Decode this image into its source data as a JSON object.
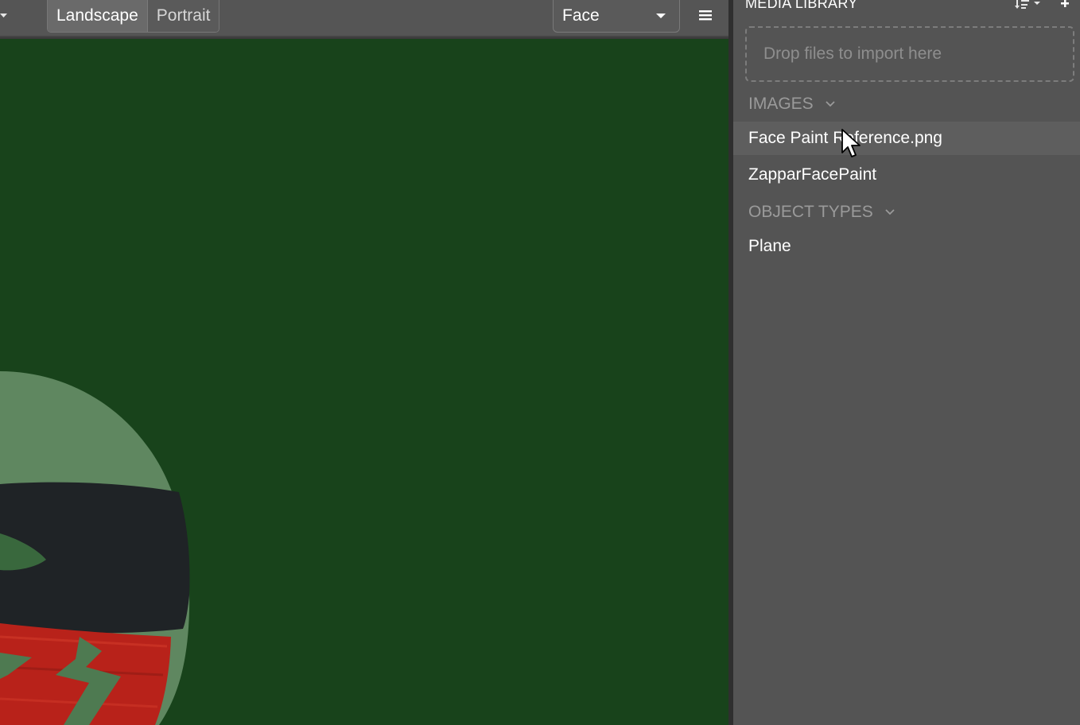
{
  "toolbar": {
    "orientation": {
      "landscape_label": "Landscape",
      "portrait_label": "Portrait",
      "selected": "Landscape"
    },
    "tracking_select": {
      "value": "Face"
    },
    "menu_icon": "hamburger-menu-icon"
  },
  "viewport": {
    "background_color": "#18431b"
  },
  "media_library": {
    "title": "MEDIA LIBRARY",
    "dropzone_text": "Drop files to import here",
    "sections": [
      {
        "label": "IMAGES",
        "items": [
          "Face Paint Reference.png",
          "ZapparFacePaint"
        ]
      },
      {
        "label": "OBJECT TYPES",
        "items": [
          "Plane"
        ]
      }
    ]
  }
}
